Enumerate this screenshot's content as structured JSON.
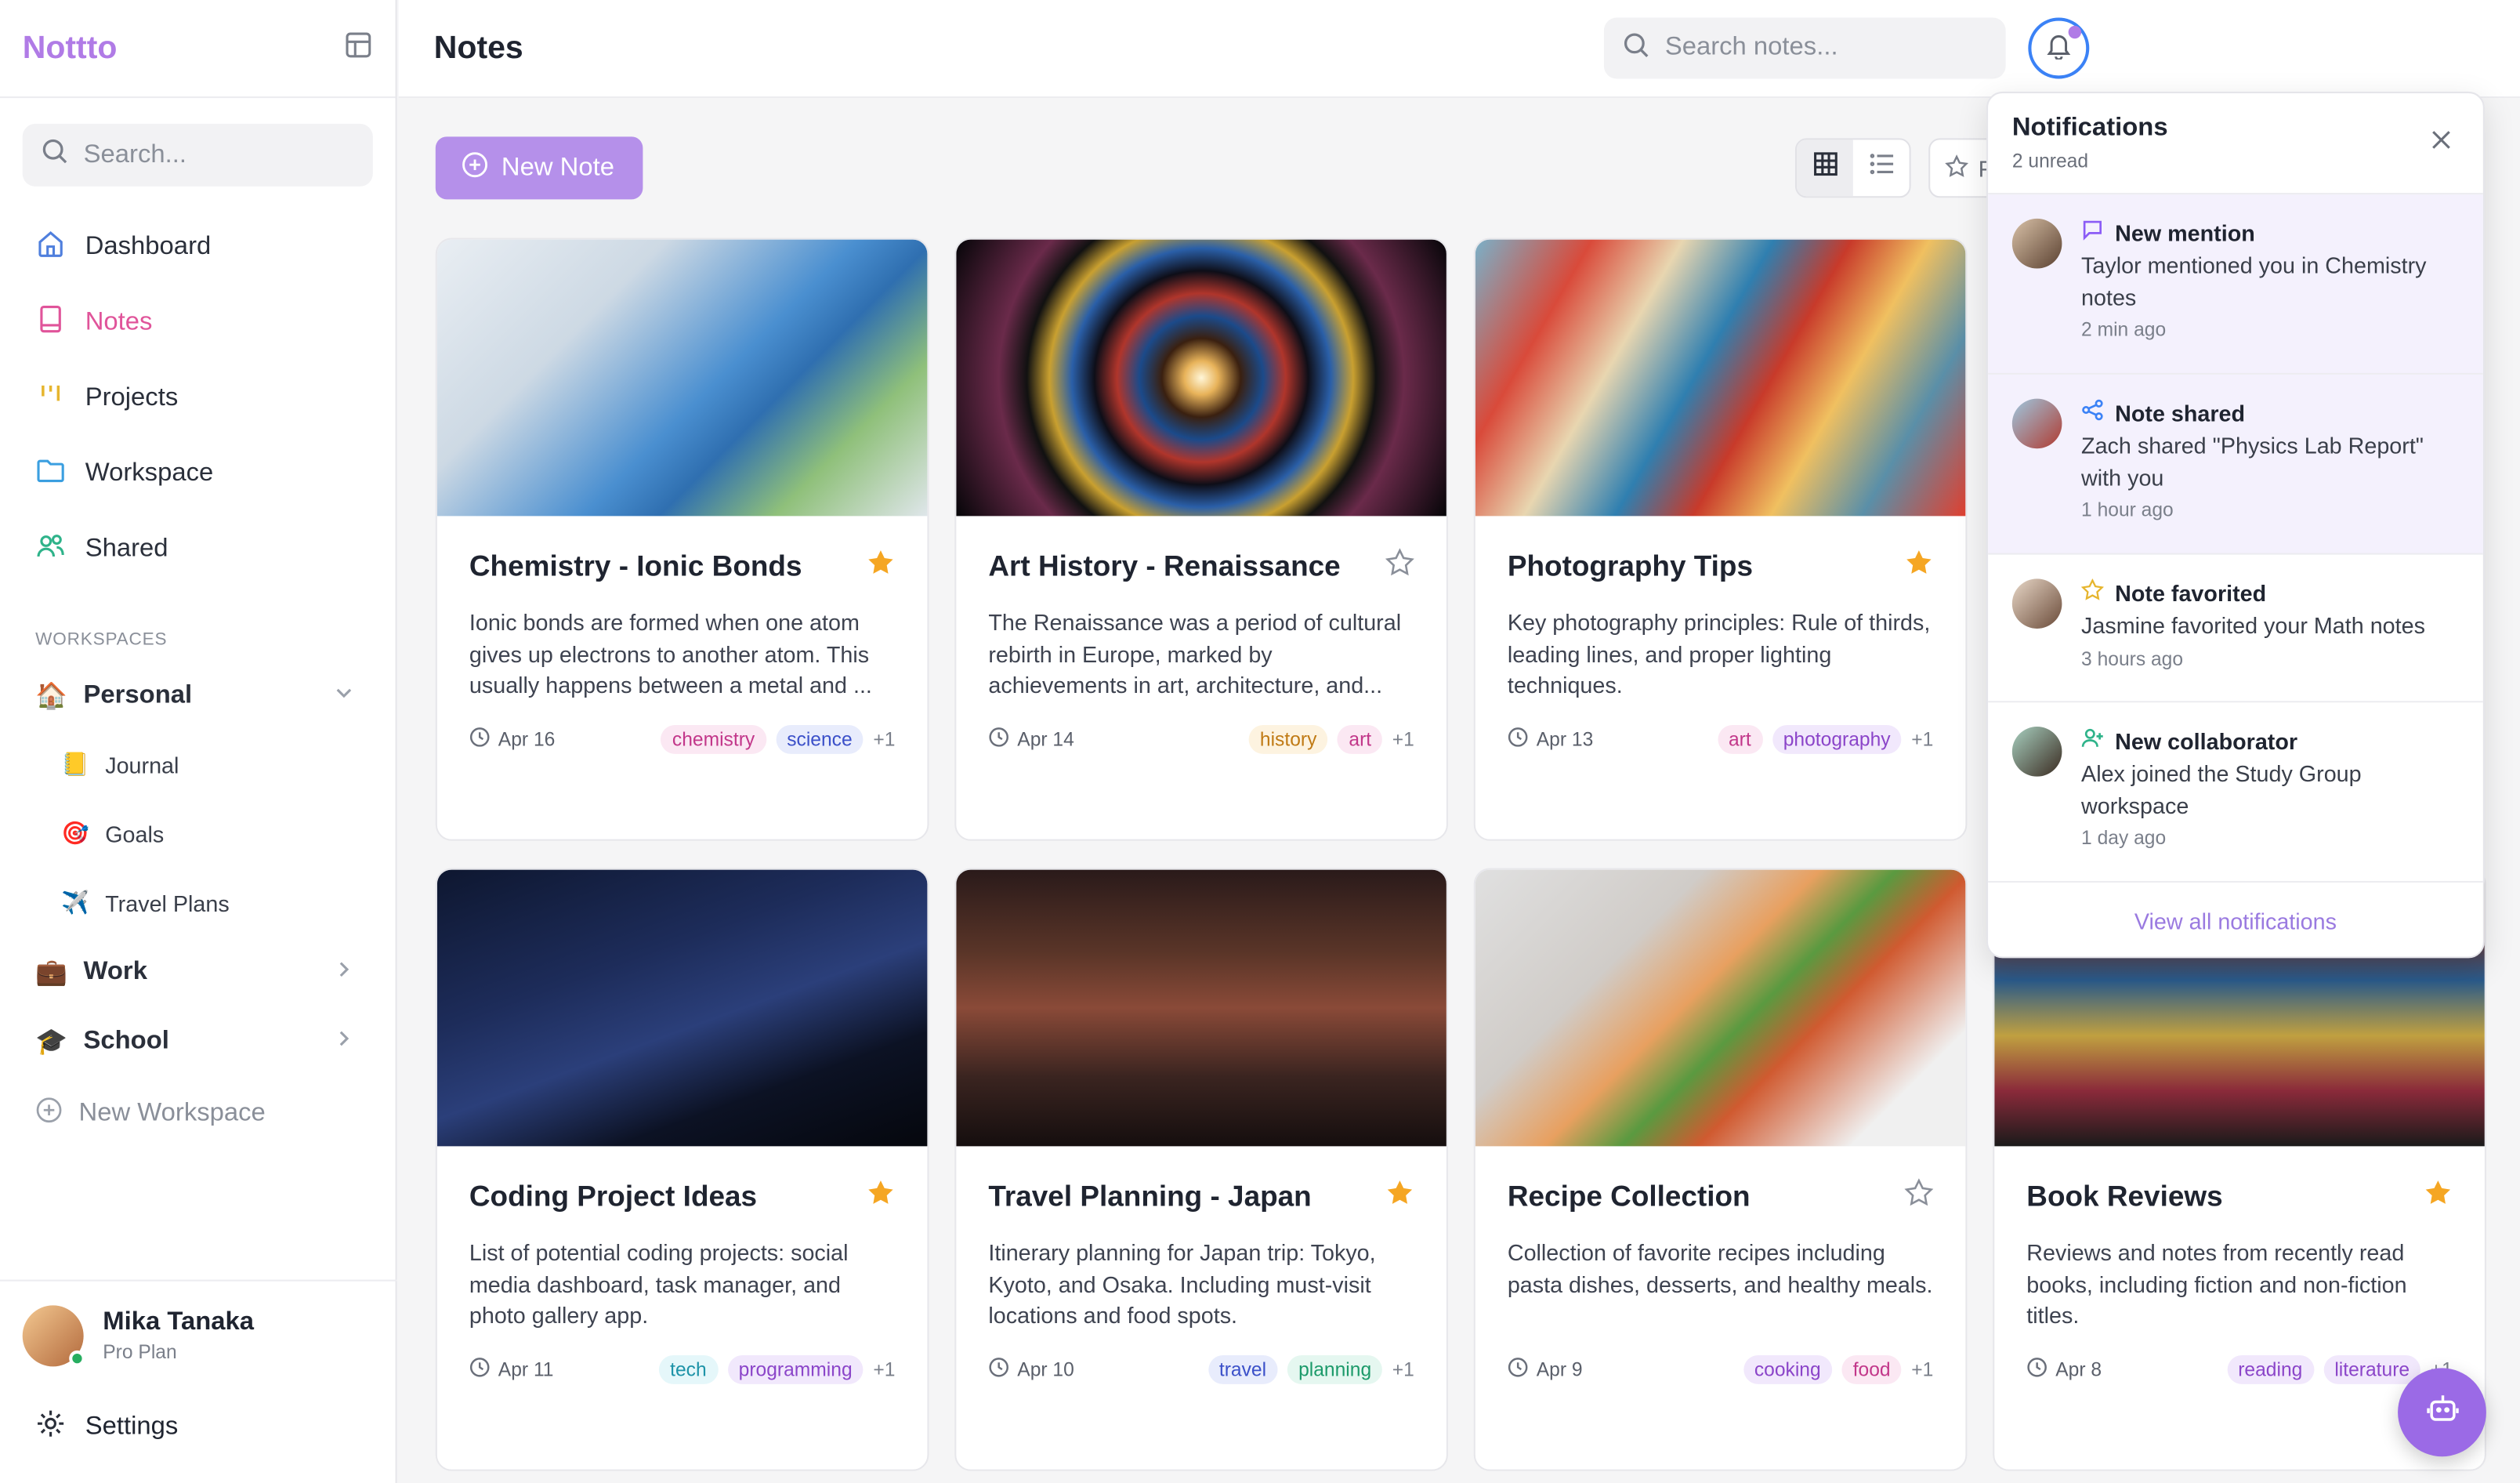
{
  "app": {
    "name": "Nottto"
  },
  "sidebar": {
    "search_placeholder": "Search...",
    "nav": [
      {
        "label": "Dashboard",
        "icon": "home-icon"
      },
      {
        "label": "Notes",
        "icon": "notebook-icon",
        "active": true
      },
      {
        "label": "Projects",
        "icon": "kanban-icon"
      },
      {
        "label": "Workspace",
        "icon": "folder-icon"
      },
      {
        "label": "Shared",
        "icon": "users-icon"
      }
    ],
    "workspaces_label": "WORKSPACES",
    "workspaces": {
      "personal": {
        "label": "Personal",
        "emoji": "🏠",
        "children": [
          {
            "label": "Journal",
            "emoji": "📒"
          },
          {
            "label": "Goals",
            "emoji": "🎯"
          },
          {
            "label": "Travel Plans",
            "emoji": "✈️"
          }
        ]
      },
      "work": {
        "label": "Work",
        "emoji": "💼"
      },
      "school": {
        "label": "School",
        "emoji": "🎓"
      }
    },
    "new_workspace": "New Workspace",
    "profile": {
      "name": "Mika Tanaka",
      "plan": "Pro Plan"
    },
    "settings": "Settings"
  },
  "header": {
    "title": "Notes",
    "search_placeholder": "Search notes..."
  },
  "toolbar": {
    "new_note": "New Note",
    "favorites_label": "F"
  },
  "notes": [
    {
      "title": "Chemistry - Ionic Bonds",
      "starred": true,
      "desc": "Ionic bonds are formed when one atom gives up electrons to another atom. This usually happens between a metal and ...",
      "date": "Apr 16",
      "tags": [
        "chemistry",
        "science"
      ],
      "more": "+1"
    },
    {
      "title": "Art History - Renaissance",
      "starred": false,
      "desc": "The Renaissance was a period of cultural rebirth in Europe, marked by achievements in art, architecture, and...",
      "date": "Apr 14",
      "tags": [
        "history",
        "art"
      ],
      "more": "+1"
    },
    {
      "title": "Photography Tips",
      "starred": true,
      "desc": "Key photography principles: Rule of thirds, leading lines, and proper lighting techniques.",
      "date": "Apr 13",
      "tags": [
        "art",
        "photography"
      ],
      "more": "+1"
    },
    {
      "title": "Coding Project Ideas",
      "starred": true,
      "desc": "List of potential coding projects: social media dashboard, task manager, and photo gallery app.",
      "date": "Apr 11",
      "tags": [
        "tech",
        "programming"
      ],
      "more": "+1"
    },
    {
      "title": "Travel Planning - Japan",
      "starred": true,
      "desc": "Itinerary planning for Japan trip: Tokyo, Kyoto, and Osaka. Including must-visit locations and food spots.",
      "date": "Apr 10",
      "tags": [
        "travel",
        "planning"
      ],
      "more": "+1"
    },
    {
      "title": "Recipe Collection",
      "starred": false,
      "desc": "Collection of favorite recipes including pasta dishes, desserts, and healthy meals.",
      "date": "Apr 9",
      "tags": [
        "cooking",
        "food"
      ],
      "more": "+1"
    },
    {
      "title": "Book Reviews",
      "starred": true,
      "desc": "Reviews and notes from recently read books, including fiction and non-fiction titles.",
      "date": "Apr 8",
      "tags": [
        "reading",
        "literature"
      ],
      "more": "+1"
    }
  ],
  "notifications": {
    "title": "Notifications",
    "subtitle": "2 unread",
    "items": [
      {
        "type": "New mention",
        "icon": "message-icon",
        "message": "Taylor mentioned you in Chemistry notes",
        "time": "2 min ago",
        "unread": true
      },
      {
        "type": "Note shared",
        "icon": "share-icon",
        "message": "Zach shared \"Physics Lab Report\" with you",
        "time": "1 hour ago",
        "unread": true
      },
      {
        "type": "Note favorited",
        "icon": "star-icon",
        "message": "Jasmine favorited your Math notes",
        "time": "3 hours ago",
        "unread": false
      },
      {
        "type": "New collaborator",
        "icon": "user-plus-icon",
        "message": "Alex joined the Study Group workspace",
        "time": "1 day ago",
        "unread": false
      }
    ],
    "view_all": "View all notifications"
  },
  "colors": {
    "brand": "#b07be6",
    "active_nav": "#e0549a",
    "star": "#f5a623",
    "accent": "#9b6ae6"
  }
}
